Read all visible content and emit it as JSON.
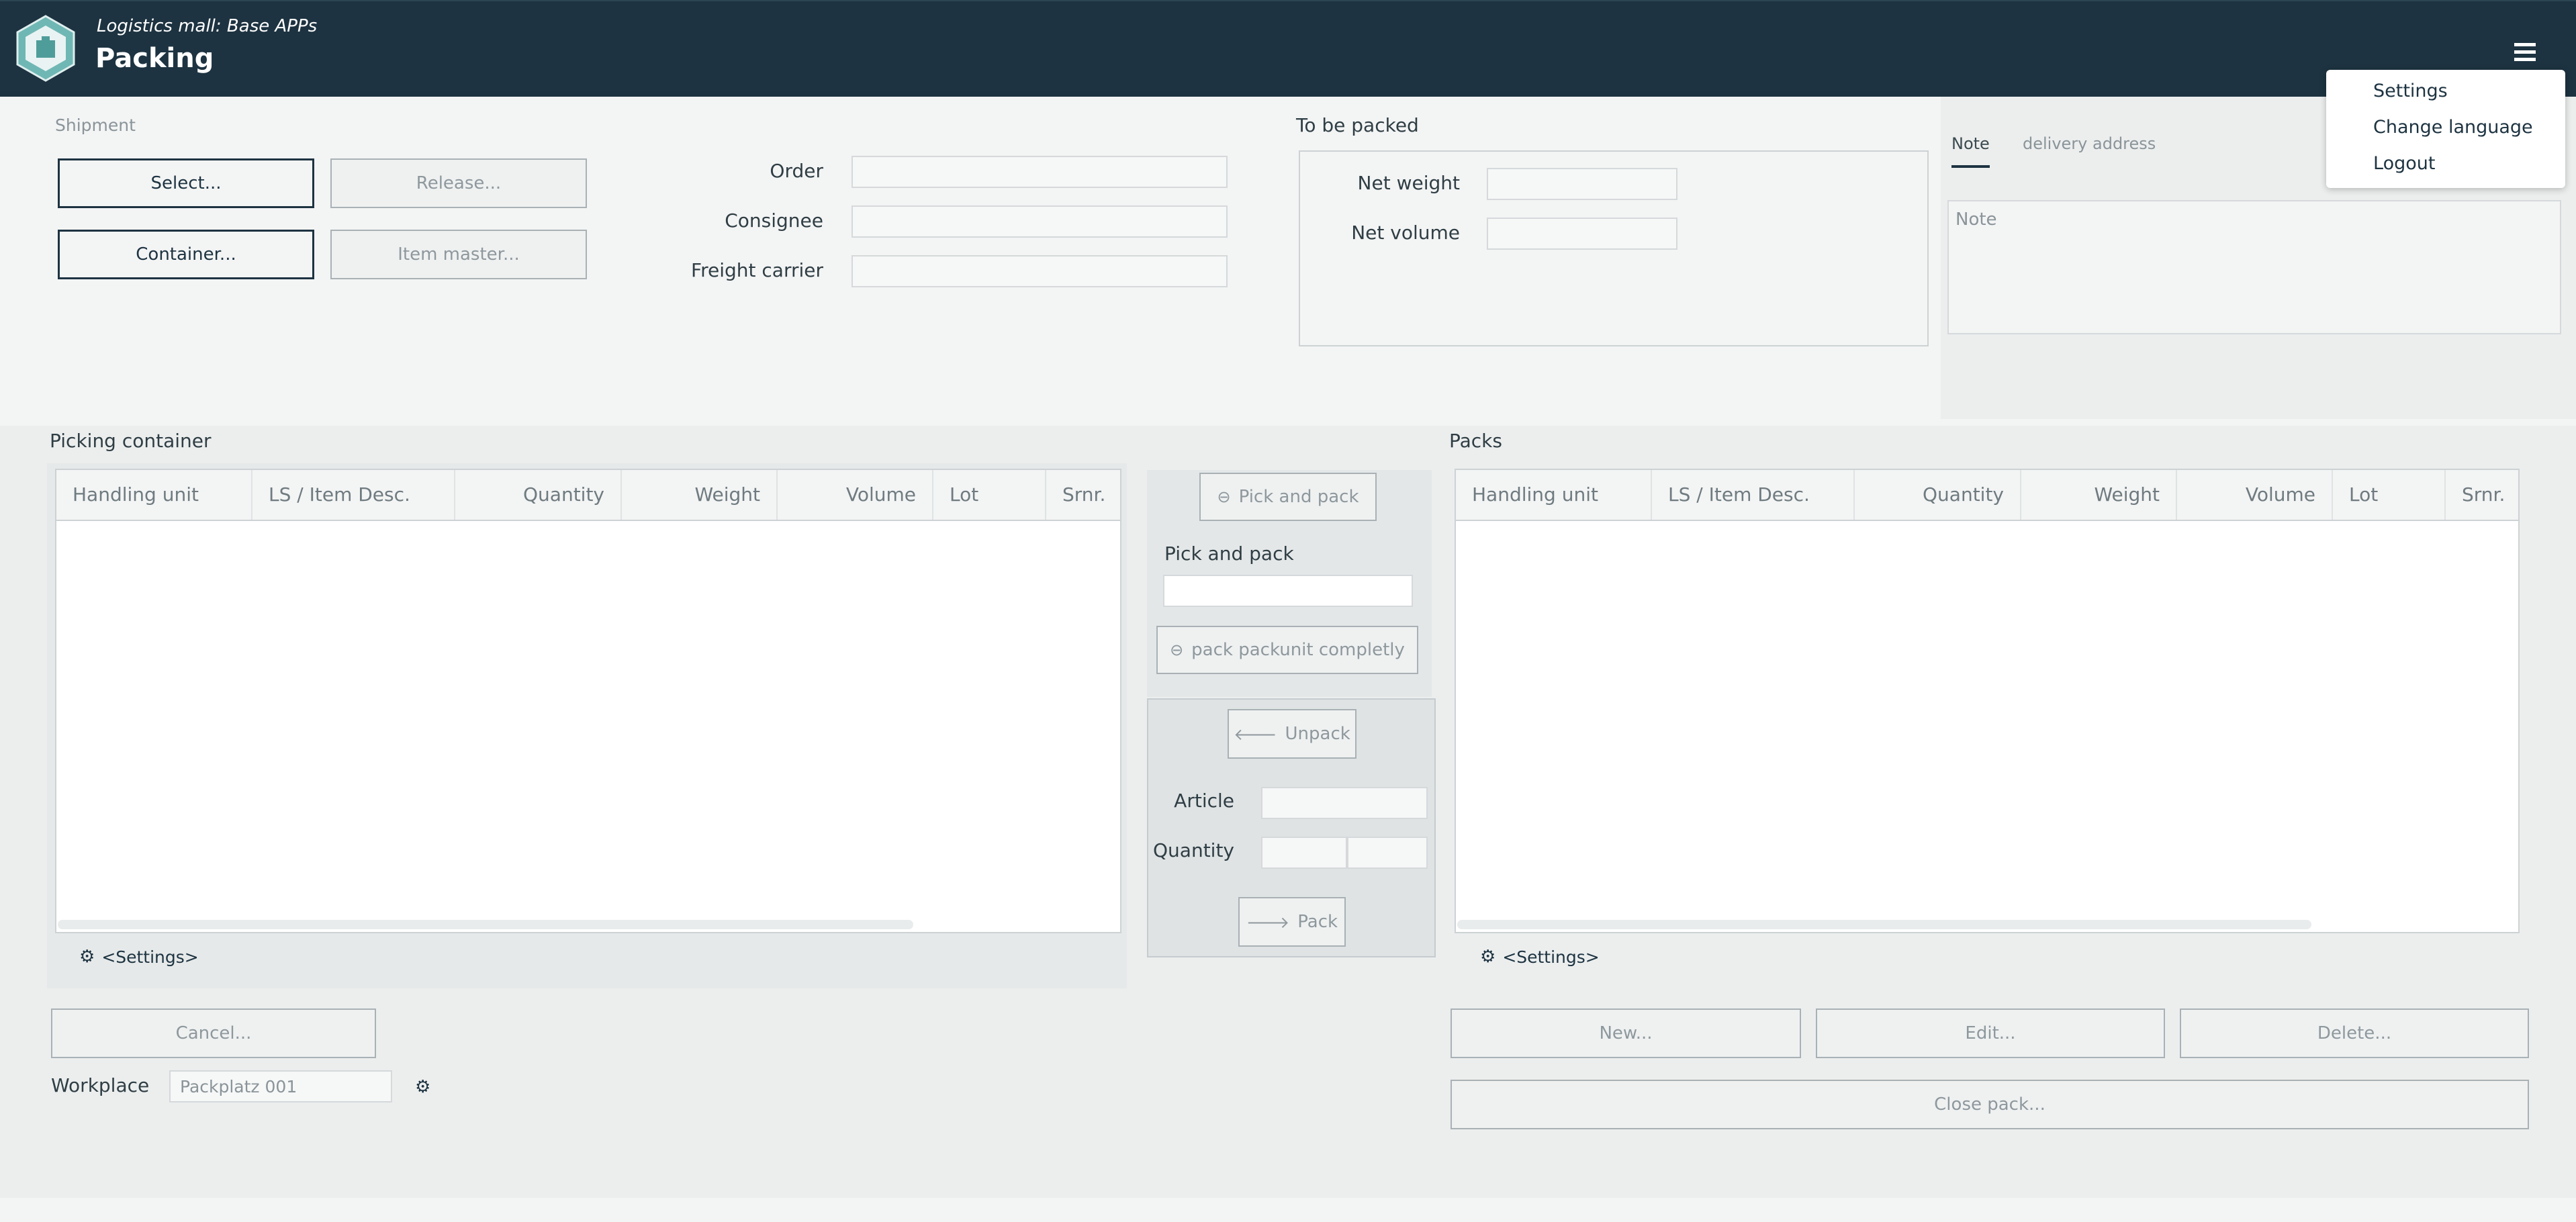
{
  "header": {
    "subtitle": "Logistics mall: Base APPs",
    "title": "Packing"
  },
  "menu": {
    "items": [
      "Settings",
      "Change language",
      "Logout"
    ]
  },
  "shipment": {
    "label": "Shipment",
    "select_btn": "Select...",
    "release_btn": "Release...",
    "container_btn": "Container...",
    "item_master_btn": "Item master..."
  },
  "order_info": {
    "order_label": "Order",
    "order_value": "",
    "consignee_label": "Consignee",
    "consignee_value": "",
    "carrier_label": "Freight carrier",
    "carrier_value": ""
  },
  "to_be_packed": {
    "label": "To be packed",
    "net_weight_label": "Net weight",
    "net_weight_value": "",
    "net_volume_label": "Net volume",
    "net_volume_value": ""
  },
  "note_tabs": {
    "tabs": [
      "Note",
      "delivery address"
    ],
    "note_placeholder": "Note"
  },
  "picking": {
    "title": "Picking container",
    "columns": [
      "Handling unit",
      "LS / Item Desc.",
      "Quantity",
      "Weight",
      "Volume",
      "Lot",
      "Srnr."
    ],
    "rows": [],
    "settings_label": "<Settings>"
  },
  "middle": {
    "pick_and_pack_btn": "Pick and pack",
    "pick_and_pack_label": "Pick and pack",
    "pick_and_pack_value": "",
    "pack_complete_btn": "pack packunit completly",
    "unpack_btn": "Unpack",
    "article_label": "Article",
    "article_value": "",
    "quantity_label": "Quantity",
    "pack_btn": "Pack"
  },
  "packs": {
    "title": "Packs",
    "columns": [
      "Handling unit",
      "LS / Item Desc.",
      "Quantity",
      "Weight",
      "Volume",
      "Lot",
      "Srnr."
    ],
    "rows": [],
    "settings_label": "<Settings>",
    "new_btn": "New...",
    "edit_btn": "Edit...",
    "delete_btn": "Delete...",
    "close_btn": "Close pack..."
  },
  "bottom_left": {
    "cancel_btn": "Cancel...",
    "workplace_label": "Workplace",
    "workplace_value": "Packplatz 001"
  },
  "colors": {
    "header_bg": "#1d3341",
    "accent": "#1d3341",
    "disabled_text": "#8e989d"
  }
}
